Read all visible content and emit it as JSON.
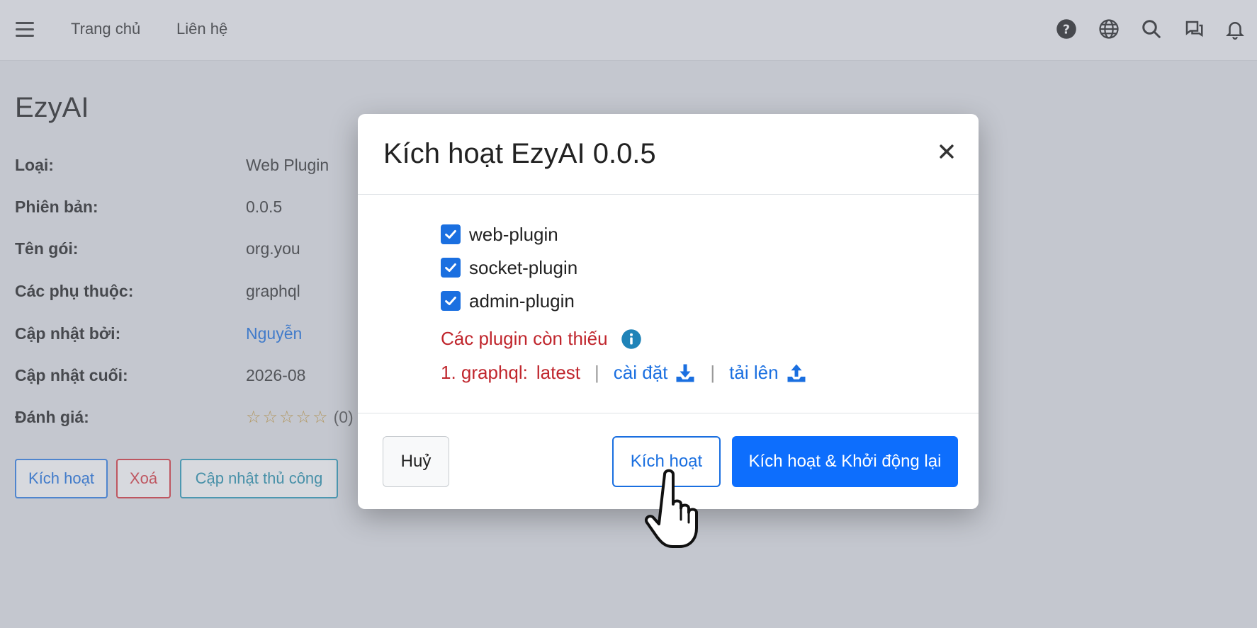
{
  "nav": {
    "home": "Trang chủ",
    "contact": "Liên hệ",
    "icons": [
      "help-icon",
      "globe-icon",
      "search-icon",
      "chat-icon",
      "bell-icon"
    ]
  },
  "page": {
    "title": "EzyAI",
    "fields": [
      {
        "label": "Loại:",
        "value": "Web Plugin"
      },
      {
        "label": "Phiên bản:",
        "value": "0.0.5"
      },
      {
        "label": "Tên gói:",
        "value": "org.you"
      },
      {
        "label": "Các phụ thuộc:",
        "value": "graphql"
      },
      {
        "label": "Cập nhật bởi:",
        "value": "Nguyễn"
      },
      {
        "label": "Cập nhật cuối:",
        "value": "2026-08"
      },
      {
        "label": "Đánh giá:",
        "value": "(0)"
      }
    ],
    "rating_stars": 0,
    "buttons": {
      "activate": "Kích hoạt",
      "delete": "Xoá",
      "manual_update": "Cập nhật thủ công"
    }
  },
  "modal": {
    "title": "Kích hoạt EzyAI 0.0.5",
    "plugins": [
      {
        "name": "web-plugin",
        "checked": true
      },
      {
        "name": "socket-plugin",
        "checked": true
      },
      {
        "name": "admin-plugin",
        "checked": true
      }
    ],
    "missing_title": "Các plugin còn thiếu",
    "missing_item": {
      "index_name": "1. graphql:",
      "version": "latest",
      "install": "cài đặt",
      "upload": "tải lên"
    },
    "buttons": {
      "cancel": "Huỷ",
      "activate": "Kích hoạt",
      "activate_restart": "Kích hoạt & Khởi động lại"
    }
  },
  "colors": {
    "primary": "#0d6efd",
    "danger": "#c0262d",
    "info": "#2290ac"
  }
}
